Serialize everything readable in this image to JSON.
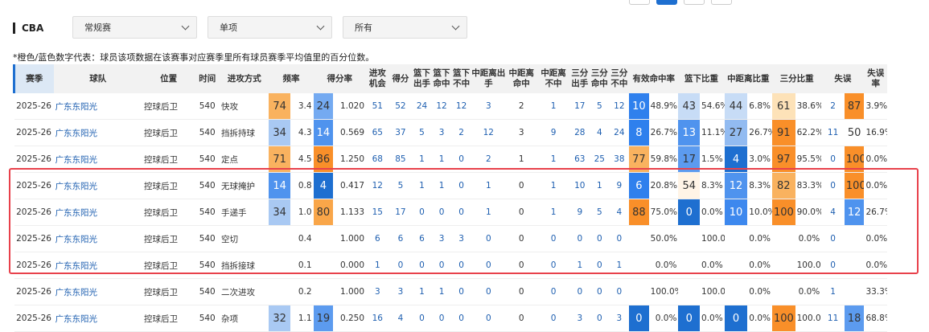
{
  "filters": {
    "league": "CBA",
    "season_type": "常规赛",
    "category": "单项",
    "scope": "所有"
  },
  "note": "*橙色/蓝色数字代表：球员该项数据在该赛事对应赛季里所有球员赛季平均值里的百分位数。",
  "columns": [
    "赛季",
    "球队",
    "位置",
    "时间",
    "进攻方式",
    "频率",
    "",
    "得分率",
    "",
    "进攻机会",
    "得分",
    "篮下出手",
    "篮下命中",
    "篮下不中",
    "中距离出手",
    "中距离命中",
    "中距离不中",
    "三分出手",
    "三分命中",
    "三分不中",
    "有效命中率",
    "",
    "篮下比重",
    "",
    "中距离比重",
    "",
    "三分比重",
    "",
    "失误",
    "",
    "失误率"
  ],
  "rows": [
    {
      "season": "2025-26",
      "team": "广东东阳光",
      "pos": "控球后卫",
      "time": "540",
      "type": "快攻",
      "freq_pct": "74",
      "freq_pct_color": "#f9b25f",
      "freq": "3.4",
      "ppp_pct": "24",
      "ppp_pct_color": "#74aaf1",
      "ppp": "1.020",
      "poss": "51",
      "pts": "52",
      "rim_a": "24",
      "rim_m": "12",
      "rim_x": "12",
      "mid_a": "3",
      "mid_m": "2",
      "mid_x": "1",
      "three_a": "17",
      "three_m": "5",
      "three_x": "12",
      "efg_pct": "10",
      "efg_pct_color": "#2f80ed",
      "efg": "48.9%",
      "rimr_pct": "43",
      "rimr_pct_color": "#c7dcf6",
      "rimr": "54.6%",
      "midr_pct": "44",
      "midr_pct_color": "#c7dcf6",
      "midr": "6.8%",
      "threer_pct": "61",
      "threer_pct_color": "#fde2b8",
      "threer": "38.6%",
      "tov": "2",
      "tov_pct": "87",
      "tov_pct_color": "#f98f29",
      "tovr": "3.9%"
    },
    {
      "season": "2025-26",
      "team": "广东东阳光",
      "pos": "控球后卫",
      "time": "540",
      "type": "挡拆持球",
      "freq_pct": "34",
      "freq_pct_color": "#a9c9f3",
      "freq": "4.3",
      "ppp_pct": "14",
      "ppp_pct_color": "#4f93ee",
      "ppp": "0.569",
      "poss": "65",
      "pts": "37",
      "rim_a": "5",
      "rim_m": "3",
      "rim_x": "2",
      "mid_a": "12",
      "mid_m": "3",
      "mid_x": "9",
      "three_a": "28",
      "three_m": "4",
      "three_x": "24",
      "efg_pct": "8",
      "efg_pct_color": "#2f80ed",
      "efg": "26.7%",
      "rimr_pct": "13",
      "rimr_pct_color": "#4f93ee",
      "rimr": "11.1%",
      "midr_pct": "27",
      "midr_pct_color": "#92bbf1",
      "midr": "26.7%",
      "threer_pct": "91",
      "threer_pct_color": "#f98f29",
      "threer": "62.2%",
      "tov": "11",
      "tov_pct": "50",
      "tov_pct_color": "#ffffff",
      "tovr": "16.9%"
    },
    {
      "season": "2025-26",
      "team": "广东东阳光",
      "pos": "控球后卫",
      "time": "540",
      "type": "定点",
      "freq_pct": "71",
      "freq_pct_color": "#f9b25f",
      "freq": "4.5",
      "ppp_pct": "86",
      "ppp_pct_color": "#f98f29",
      "ppp": "1.250",
      "poss": "68",
      "pts": "85",
      "rim_a": "1",
      "rim_m": "1",
      "rim_x": "0",
      "mid_a": "2",
      "mid_m": "1",
      "mid_x": "1",
      "three_a": "63",
      "three_m": "25",
      "three_x": "38",
      "efg_pct": "77",
      "efg_pct_color": "#f9b25f",
      "efg": "59.8%",
      "rimr_pct": "17",
      "rimr_pct_color": "#5c9bef",
      "rimr": "1.5%",
      "midr_pct": "4",
      "midr_pct_color": "#1e6fd0",
      "midr": "3.0%",
      "threer_pct": "97",
      "threer_pct_color": "#f98f29",
      "threer": "95.5%",
      "tov": "0",
      "tov_pct": "100",
      "tov_pct_color": "#f98f29",
      "tovr": "0.0%"
    },
    {
      "season": "2025-26",
      "team": "广东东阳光",
      "pos": "控球后卫",
      "time": "540",
      "type": "无球掩护",
      "freq_pct": "14",
      "freq_pct_color": "#4f93ee",
      "freq": "0.8",
      "ppp_pct": "4",
      "ppp_pct_color": "#1e6fd0",
      "ppp": "0.417",
      "poss": "12",
      "pts": "5",
      "rim_a": "1",
      "rim_m": "1",
      "rim_x": "0",
      "mid_a": "1",
      "mid_m": "0",
      "mid_x": "1",
      "three_a": "10",
      "three_m": "1",
      "three_x": "9",
      "efg_pct": "6",
      "efg_pct_color": "#2f80ed",
      "efg": "20.8%",
      "rimr_pct": "54",
      "rimr_pct_color": "#fff4e6",
      "rimr": "8.3%",
      "midr_pct": "12",
      "midr_pct_color": "#4f93ee",
      "midr": "8.3%",
      "threer_pct": "82",
      "threer_pct_color": "#f9b25f",
      "threer": "83.3%",
      "tov": "0",
      "tov_pct": "100",
      "tov_pct_color": "#f98f29",
      "tovr": "0.0%"
    },
    {
      "season": "2025-26",
      "team": "广东东阳光",
      "pos": "控球后卫",
      "time": "540",
      "type": "手递手",
      "freq_pct": "34",
      "freq_pct_color": "#a9c9f3",
      "freq": "1.0",
      "ppp_pct": "80",
      "ppp_pct_color": "#f9a649",
      "ppp": "1.133",
      "poss": "15",
      "pts": "17",
      "rim_a": "0",
      "rim_m": "0",
      "rim_x": "0",
      "mid_a": "1",
      "mid_m": "0",
      "mid_x": "1",
      "three_a": "9",
      "three_m": "5",
      "three_x": "4",
      "efg_pct": "88",
      "efg_pct_color": "#f98f29",
      "efg": "75.0%",
      "rimr_pct": "0",
      "rimr_pct_color": "#1e6fd0",
      "rimr": "0.0%",
      "midr_pct": "10",
      "midr_pct_color": "#3d88ee",
      "midr": "10.0%",
      "threer_pct": "100",
      "threer_pct_color": "#f98f29",
      "threer": "90.0%",
      "tov": "4",
      "tov_pct": "12",
      "tov_pct_color": "#4f93ee",
      "tovr": "26.7%"
    },
    {
      "season": "2025-26",
      "team": "广东东阳光",
      "pos": "控球后卫",
      "time": "540",
      "type": "空切",
      "freq_pct": "",
      "freq_pct_color": "#ffffff",
      "freq": "0.4",
      "ppp_pct": "",
      "ppp_pct_color": "#ffffff",
      "ppp": "1.000",
      "poss": "6",
      "pts": "6",
      "rim_a": "6",
      "rim_m": "3",
      "rim_x": "3",
      "mid_a": "0",
      "mid_m": "0",
      "mid_x": "0",
      "three_a": "0",
      "three_m": "0",
      "three_x": "0",
      "efg_pct": "",
      "efg_pct_color": "#ffffff",
      "efg": "50.0%",
      "rimr_pct": "",
      "rimr_pct_color": "#ffffff",
      "rimr": "100.0%",
      "midr_pct": "",
      "midr_pct_color": "#ffffff",
      "midr": "0.0%",
      "threer_pct": "",
      "threer_pct_color": "#ffffff",
      "threer": "0.0%",
      "tov": "0",
      "tov_pct": "",
      "tov_pct_color": "#ffffff",
      "tovr": "0.0%"
    },
    {
      "season": "2025-26",
      "team": "广东东阳光",
      "pos": "控球后卫",
      "time": "540",
      "type": "挡拆接球",
      "freq_pct": "",
      "freq_pct_color": "#ffffff",
      "freq": "0.1",
      "ppp_pct": "",
      "ppp_pct_color": "#ffffff",
      "ppp": "0.000",
      "poss": "1",
      "pts": "0",
      "rim_a": "0",
      "rim_m": "0",
      "rim_x": "0",
      "mid_a": "0",
      "mid_m": "0",
      "mid_x": "0",
      "three_a": "1",
      "three_m": "0",
      "three_x": "1",
      "efg_pct": "",
      "efg_pct_color": "#ffffff",
      "efg": "0.0%",
      "rimr_pct": "",
      "rimr_pct_color": "#ffffff",
      "rimr": "0.0%",
      "midr_pct": "",
      "midr_pct_color": "#ffffff",
      "midr": "0.0%",
      "threer_pct": "",
      "threer_pct_color": "#ffffff",
      "threer": "100.0%",
      "tov": "0",
      "tov_pct": "",
      "tov_pct_color": "#ffffff",
      "tovr": "0.0%"
    },
    {
      "season": "2025-26",
      "team": "广东东阳光",
      "pos": "控球后卫",
      "time": "540",
      "type": "二次进攻",
      "freq_pct": "",
      "freq_pct_color": "#ffffff",
      "freq": "0.2",
      "ppp_pct": "",
      "ppp_pct_color": "#ffffff",
      "ppp": "1.000",
      "poss": "3",
      "pts": "3",
      "rim_a": "1",
      "rim_m": "1",
      "rim_x": "0",
      "mid_a": "0",
      "mid_m": "0",
      "mid_x": "0",
      "three_a": "0",
      "three_m": "0",
      "three_x": "0",
      "efg_pct": "",
      "efg_pct_color": "#ffffff",
      "efg": "100.0%",
      "rimr_pct": "",
      "rimr_pct_color": "#ffffff",
      "rimr": "100.0%",
      "midr_pct": "",
      "midr_pct_color": "#ffffff",
      "midr": "0.0%",
      "threer_pct": "",
      "threer_pct_color": "#ffffff",
      "threer": "0.0%",
      "tov": "1",
      "tov_pct": "",
      "tov_pct_color": "#ffffff",
      "tovr": "33.3%"
    },
    {
      "season": "2025-26",
      "team": "广东东阳光",
      "pos": "控球后卫",
      "time": "540",
      "type": "杂项",
      "freq_pct": "32",
      "freq_pct_color": "#a9c9f3",
      "freq": "1.1",
      "ppp_pct": "19",
      "ppp_pct_color": "#5c9bef",
      "ppp": "0.250",
      "poss": "16",
      "pts": "4",
      "rim_a": "0",
      "rim_m": "0",
      "rim_x": "0",
      "mid_a": "0",
      "mid_m": "0",
      "mid_x": "0",
      "three_a": "3",
      "three_m": "0",
      "three_x": "3",
      "efg_pct": "0",
      "efg_pct_color": "#1e6fd0",
      "efg": "0.0%",
      "rimr_pct": "0",
      "rimr_pct_color": "#1e6fd0",
      "rimr": "0.0%",
      "midr_pct": "0",
      "midr_pct_color": "#1e6fd0",
      "midr": "0.0%",
      "threer_pct": "100",
      "threer_pct_color": "#f98f29",
      "threer": "100.0%",
      "tov": "11",
      "tov_pct": "18",
      "tov_pct_color": "#5c9bef",
      "tovr": "68.8%"
    }
  ]
}
